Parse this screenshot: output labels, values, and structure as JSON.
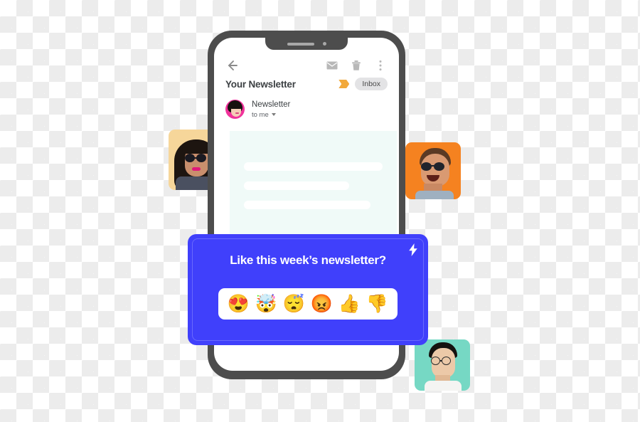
{
  "mail": {
    "toolbar": {
      "back_icon": "back-arrow-icon",
      "mail_icon": "envelope-icon",
      "delete_icon": "trash-icon",
      "more_icon": "more-vertical-icon"
    },
    "subject": "Your Newsletter",
    "flag_icon": "flag-ribbon-icon",
    "label": "Inbox",
    "sender": {
      "name": "Newsletter",
      "recipient": "to me",
      "expand_icon": "chevron-down-icon",
      "avatar_icon": "sender-avatar",
      "avatar_bg": "#F0329B"
    },
    "body_placeholder_lines": 3
  },
  "feedback": {
    "title": "Like this week’s newsletter?",
    "bolt_icon": "lightning-bolt-icon",
    "card_color": "#4040FB",
    "reactions": [
      {
        "name": "smiling-face-with-heart-eyes",
        "glyph": "😍"
      },
      {
        "name": "exploding-head",
        "glyph": "🤯"
      },
      {
        "name": "sleeping-face",
        "glyph": "😴"
      },
      {
        "name": "pouting-face",
        "glyph": "😡"
      },
      {
        "name": "thumbs-up",
        "glyph": "👍"
      },
      {
        "name": "thumbs-down",
        "glyph": "👎"
      }
    ]
  },
  "avatars": [
    {
      "name": "avatar-tile-left",
      "bg": "#F6D69A"
    },
    {
      "name": "avatar-tile-right",
      "bg": "#F58220"
    },
    {
      "name": "avatar-tile-bottom",
      "bg": "#76D8C4"
    }
  ],
  "device": {
    "frame_color": "#4D4D4D",
    "screen_panel_color": "#F0FAF8"
  }
}
